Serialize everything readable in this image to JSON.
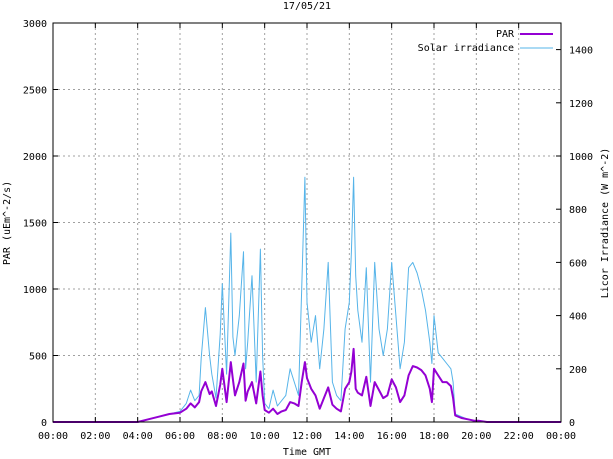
{
  "chart_data": {
    "type": "line",
    "title": "17/05/21",
    "xlabel": "Time GMT",
    "ylabel": "PAR (uEm^-2/s)",
    "y2label": "Licor Irradiance (W m^-2)",
    "xlim": [
      0,
      24
    ],
    "ylim": [
      0,
      3000
    ],
    "y2lim": [
      0,
      1500
    ],
    "x_ticks": [
      "00:00",
      "02:00",
      "04:00",
      "06:00",
      "08:00",
      "10:00",
      "12:00",
      "14:00",
      "16:00",
      "18:00",
      "20:00",
      "22:00",
      "00:00"
    ],
    "y_ticks": [
      "0",
      "500",
      "1000",
      "1500",
      "2000",
      "2500",
      "3000"
    ],
    "y2_ticks": [
      "0",
      "200",
      "400",
      "600",
      "800",
      "1000",
      "1200",
      "1400"
    ],
    "grid": true,
    "legend_position": "top-right",
    "series": [
      {
        "name": "PAR",
        "axis": "left",
        "color": "#9400d3",
        "x": [
          0,
          4.0,
          4.5,
          5.0,
          5.5,
          6.0,
          6.3,
          6.5,
          6.7,
          6.9,
          7.0,
          7.2,
          7.4,
          7.5,
          7.7,
          7.9,
          8.0,
          8.2,
          8.4,
          8.5,
          8.6,
          8.8,
          9.0,
          9.1,
          9.2,
          9.4,
          9.6,
          9.8,
          9.9,
          10.0,
          10.2,
          10.4,
          10.6,
          10.8,
          11.0,
          11.2,
          11.4,
          11.6,
          11.75,
          11.9,
          12.0,
          12.2,
          12.4,
          12.6,
          12.8,
          13.0,
          13.2,
          13.4,
          13.6,
          13.8,
          14.0,
          14.1,
          14.2,
          14.3,
          14.4,
          14.6,
          14.8,
          15.0,
          15.2,
          15.4,
          15.6,
          15.8,
          16.0,
          16.2,
          16.4,
          16.6,
          16.8,
          17.0,
          17.2,
          17.4,
          17.6,
          17.8,
          17.9,
          18.0,
          18.2,
          18.4,
          18.6,
          18.8,
          18.9,
          19.0,
          19.3,
          19.6,
          19.9,
          20.1,
          20.5,
          24.0
        ],
        "y": [
          0,
          0,
          20,
          40,
          60,
          70,
          100,
          140,
          110,
          150,
          230,
          300,
          210,
          230,
          120,
          280,
          400,
          150,
          450,
          320,
          200,
          300,
          440,
          160,
          230,
          300,
          140,
          380,
          200,
          90,
          70,
          100,
          60,
          80,
          90,
          150,
          140,
          120,
          300,
          450,
          330,
          250,
          200,
          100,
          180,
          260,
          130,
          100,
          80,
          250,
          300,
          380,
          550,
          250,
          220,
          200,
          340,
          120,
          300,
          240,
          180,
          200,
          320,
          260,
          150,
          200,
          350,
          420,
          410,
          390,
          350,
          250,
          150,
          400,
          350,
          300,
          300,
          270,
          180,
          50,
          30,
          20,
          10,
          10,
          0,
          0
        ]
      },
      {
        "name": "Solar irradiance",
        "axis": "right",
        "color": "#56b4e9",
        "x": [
          0,
          4.0,
          4.5,
          5.0,
          5.5,
          6.0,
          6.3,
          6.5,
          6.7,
          6.9,
          7.0,
          7.2,
          7.4,
          7.5,
          7.7,
          7.9,
          8.0,
          8.2,
          8.4,
          8.5,
          8.6,
          8.8,
          9.0,
          9.1,
          9.2,
          9.4,
          9.6,
          9.8,
          9.9,
          10.0,
          10.2,
          10.4,
          10.6,
          10.8,
          11.0,
          11.2,
          11.4,
          11.6,
          11.75,
          11.9,
          12.0,
          12.2,
          12.4,
          12.6,
          12.8,
          13.0,
          13.2,
          13.4,
          13.6,
          13.8,
          14.0,
          14.1,
          14.2,
          14.3,
          14.4,
          14.6,
          14.8,
          15.0,
          15.2,
          15.4,
          15.6,
          15.8,
          16.0,
          16.2,
          16.4,
          16.6,
          16.8,
          17.0,
          17.2,
          17.4,
          17.6,
          17.8,
          17.9,
          18.0,
          18.2,
          18.4,
          18.6,
          18.8,
          18.9,
          19.0,
          19.3,
          19.6,
          19.9,
          20.1,
          20.5,
          24.0
        ],
        "y": [
          0,
          0,
          10,
          20,
          30,
          40,
          70,
          120,
          80,
          100,
          240,
          430,
          250,
          180,
          90,
          330,
          520,
          180,
          710,
          320,
          250,
          400,
          640,
          200,
          300,
          550,
          150,
          650,
          250,
          70,
          50,
          120,
          60,
          80,
          100,
          200,
          150,
          100,
          500,
          920,
          450,
          300,
          400,
          200,
          350,
          600,
          150,
          100,
          80,
          350,
          450,
          640,
          920,
          550,
          420,
          300,
          580,
          150,
          600,
          350,
          250,
          350,
          600,
          400,
          200,
          300,
          580,
          600,
          560,
          500,
          420,
          300,
          220,
          400,
          260,
          240,
          220,
          200,
          150,
          30,
          20,
          10,
          5,
          5,
          0,
          0
        ]
      }
    ]
  }
}
